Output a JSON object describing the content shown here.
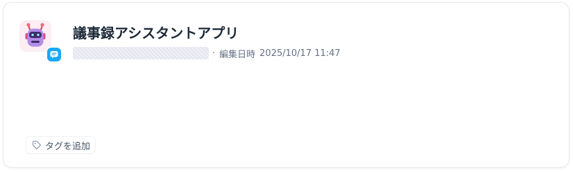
{
  "app": {
    "title": "議事録アシスタントアプリ",
    "icon": "robot-icon",
    "badge_icon": "chat-icon",
    "badge_color": "#1aa8f5",
    "icon_background": "#fdeef4"
  },
  "meta": {
    "separator": "·",
    "edited_label": "編集日時",
    "edited_datetime": "2025/10/17 11:47"
  },
  "tags": {
    "add_label": "タグを追加",
    "icon": "tag-icon"
  }
}
